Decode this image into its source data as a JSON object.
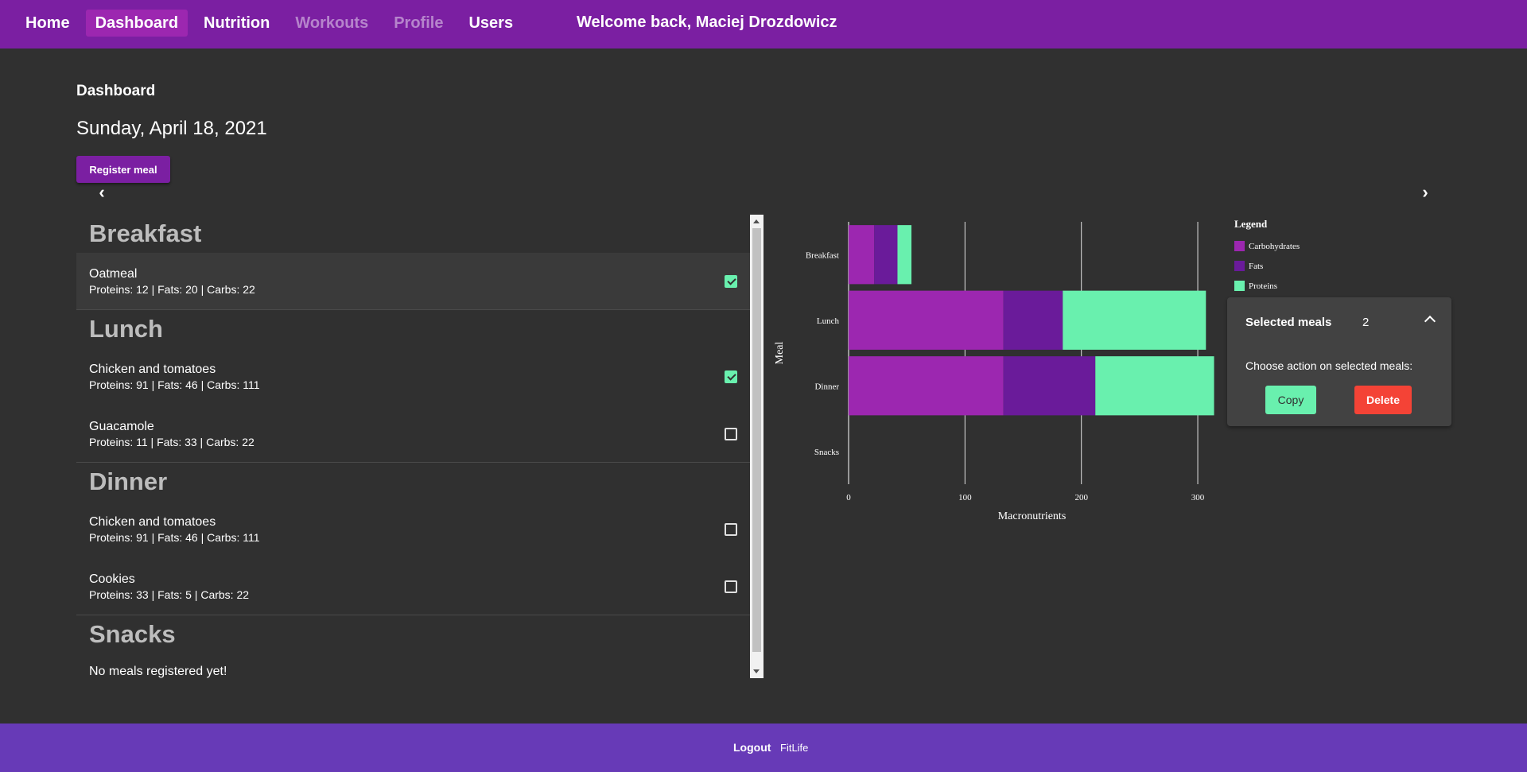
{
  "nav": {
    "items": [
      {
        "label": "Home",
        "state": "normal"
      },
      {
        "label": "Dashboard",
        "state": "active"
      },
      {
        "label": "Nutrition",
        "state": "normal"
      },
      {
        "label": "Workouts",
        "state": "disabled"
      },
      {
        "label": "Profile",
        "state": "disabled"
      },
      {
        "label": "Users",
        "state": "normal"
      }
    ],
    "welcome": "Welcome back, Maciej Drozdowicz"
  },
  "page": {
    "title": "Dashboard",
    "date": "Sunday, April 18, 2021",
    "register_label": "Register meal",
    "prev_icon": "chevron-left-icon",
    "next_icon": "chevron-right-icon"
  },
  "meals": {
    "sections": [
      {
        "title": "Breakfast",
        "items": [
          {
            "name": "Oatmeal",
            "macros": "Proteins: 12 | Fats: 20 | Carbs: 22",
            "checked": true
          }
        ]
      },
      {
        "title": "Lunch",
        "items": [
          {
            "name": "Chicken and tomatoes",
            "macros": "Proteins: 91 | Fats: 46 | Carbs: 111",
            "checked": true
          },
          {
            "name": "Guacamole",
            "macros": "Proteins: 11 | Fats: 33 | Carbs: 22",
            "checked": false
          }
        ]
      },
      {
        "title": "Dinner",
        "items": [
          {
            "name": "Chicken and tomatoes",
            "macros": "Proteins: 91 | Fats: 46 | Carbs: 111",
            "checked": false
          },
          {
            "name": "Cookies",
            "macros": "Proteins: 33 | Fats: 5 | Carbs: 22",
            "checked": false
          }
        ]
      },
      {
        "title": "Snacks",
        "items": [],
        "empty_text": "No meals registered yet!"
      }
    ]
  },
  "chart_data": {
    "type": "bar",
    "orientation": "horizontal",
    "stacked": true,
    "categories": [
      "Breakfast",
      "Lunch",
      "Dinner",
      "Snacks"
    ],
    "series": [
      {
        "name": "Carbohydrates",
        "color": "#9c27b0",
        "values": [
          22,
          133,
          133,
          0
        ]
      },
      {
        "name": "Fats",
        "color": "#6a1b9a",
        "values": [
          20,
          51,
          79,
          0
        ]
      },
      {
        "name": "Proteins",
        "color": "#69f0ae",
        "values": [
          12,
          123,
          102,
          0
        ]
      }
    ],
    "xlabel": "Macronutrients",
    "ylabel": "Meal",
    "xticks": [
      0,
      100,
      200,
      300
    ],
    "xlim": [
      0,
      315
    ],
    "grid": "vertical",
    "legend_title": "Legend",
    "legend_placement": "right"
  },
  "selected": {
    "label": "Selected meals",
    "count": "2",
    "prompt": "Choose action on selected meals:",
    "copy_label": "Copy",
    "delete_label": "Delete",
    "collapse_icon": "chevron-up-icon"
  },
  "footer": {
    "logout_label": "Logout",
    "brand": "FitLife"
  }
}
